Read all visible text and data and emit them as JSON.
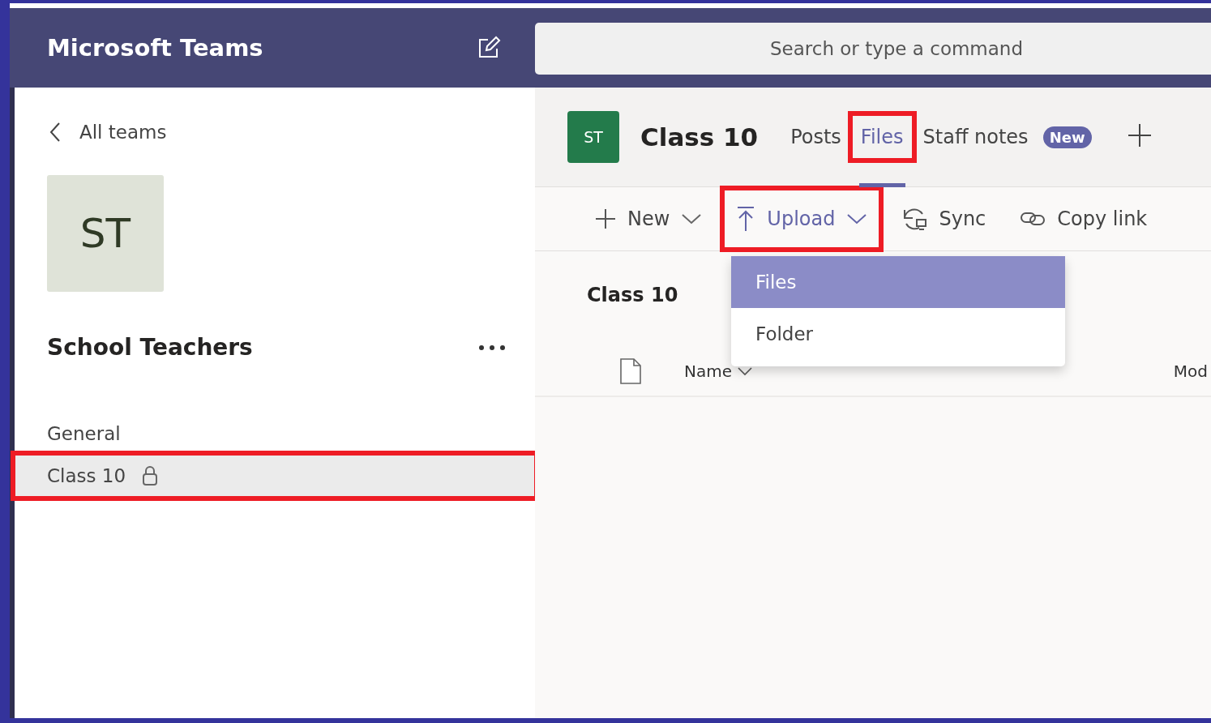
{
  "app": {
    "title": "Microsoft Teams"
  },
  "search": {
    "placeholder": "Search or type a command"
  },
  "sidebar": {
    "back_link": "All teams",
    "team_avatar": "ST",
    "team_name": "School Teachers",
    "channels": [
      {
        "name": "General",
        "selected": false,
        "locked": false,
        "highlighted": false
      },
      {
        "name": "Class 10",
        "selected": true,
        "locked": true,
        "highlighted": true
      }
    ]
  },
  "channel_header": {
    "avatar": "ST",
    "title": "Class 10",
    "tabs": [
      {
        "label": "Posts",
        "selected": false,
        "highlighted": false
      },
      {
        "label": "Files",
        "selected": true,
        "highlighted": true
      },
      {
        "label": "Staff notes",
        "selected": false,
        "highlighted": false,
        "badge": "New"
      }
    ]
  },
  "toolbar": [
    {
      "kind": "new",
      "label": "New",
      "dropdown": true,
      "active": false,
      "highlighted": false
    },
    {
      "kind": "upload",
      "label": "Upload",
      "dropdown": true,
      "active": true,
      "highlighted": true
    },
    {
      "kind": "sync",
      "label": "Sync",
      "dropdown": false,
      "active": false,
      "highlighted": false
    },
    {
      "kind": "link",
      "label": "Copy link",
      "dropdown": false,
      "active": false,
      "highlighted": false
    }
  ],
  "upload_menu": {
    "items": [
      {
        "label": "Files",
        "selected": true
      },
      {
        "label": "Folder",
        "selected": false
      }
    ]
  },
  "files": {
    "breadcrumb": "Class 10",
    "columns": [
      {
        "label": "Name",
        "sorted": true
      },
      {
        "label": "Mod",
        "sorted": false
      }
    ]
  }
}
